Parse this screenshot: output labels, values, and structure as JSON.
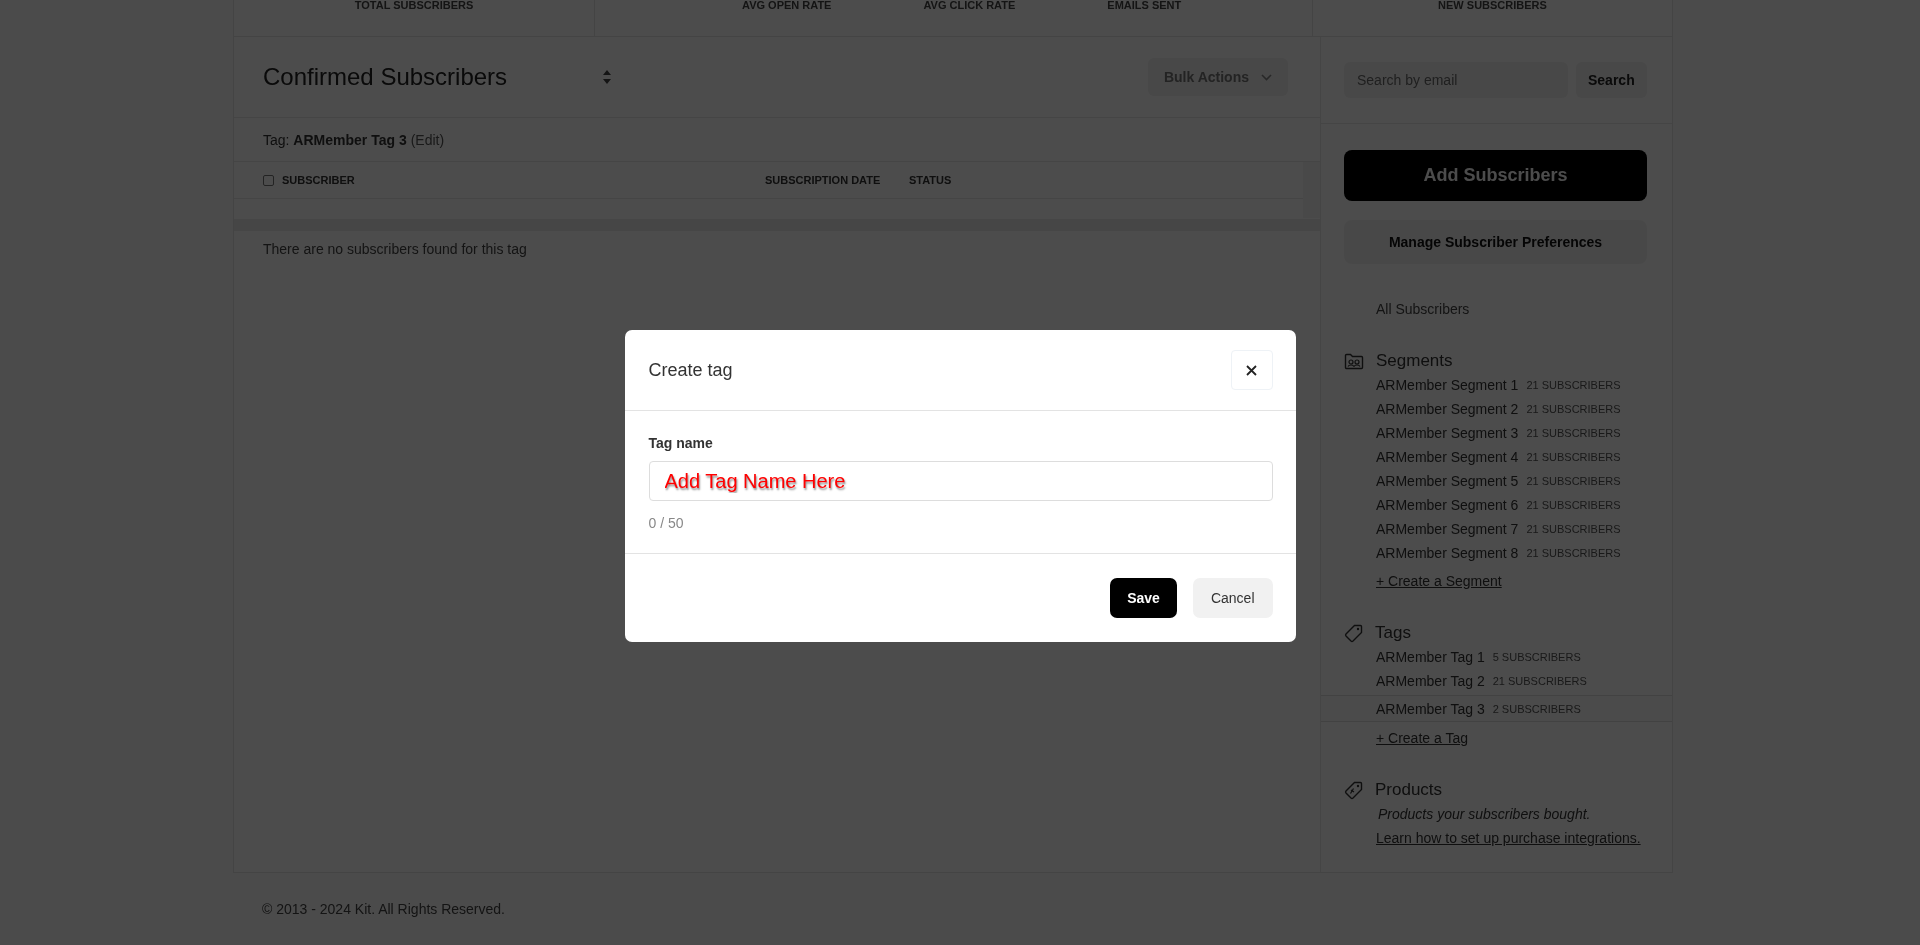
{
  "stats_header": {
    "groups": [
      [
        "TOTAL SUBSCRIBERS"
      ],
      [
        "AVG OPEN RATE",
        "AVG CLICK RATE",
        "EMAILS SENT"
      ],
      [
        "NEW SUBSCRIBERS"
      ]
    ]
  },
  "subscribers_panel": {
    "title": "Confirmed Subscribers",
    "bulk_actions": "Bulk Actions",
    "filter_text": "Tag: **ARMember Tag 3**",
    "filter_edit": "(Edit)",
    "select_all_checked": false,
    "columns": [
      "SUBSCRIBER",
      "SUBSCRIPTION DATE",
      "STATUS"
    ],
    "empty_message": "There are no subscribers found for this tag"
  },
  "sidebar": {
    "search": {
      "placeholder": "Search by email",
      "button": "Search"
    },
    "add_button": "Add Subscribers",
    "manage_button": "Manage Subscriber Preferences",
    "all_link": "All Subscribers",
    "sections": [
      {
        "kind": "segments",
        "title": "Segments",
        "items": [
          {
            "name": "ARMember Segment 1",
            "count": "21 SUBSCRIBERS",
            "selected": false
          },
          {
            "name": "ARMember Segment 2",
            "count": "21 SUBSCRIBERS",
            "selected": false
          },
          {
            "name": "ARMember Segment 3",
            "count": "21 SUBSCRIBERS",
            "selected": false
          },
          {
            "name": "ARMember Segment 4",
            "count": "21 SUBSCRIBERS",
            "selected": false
          },
          {
            "name": "ARMember Segment 5",
            "count": "21 SUBSCRIBERS",
            "selected": false
          },
          {
            "name": "ARMember Segment 6",
            "count": "21 SUBSCRIBERS",
            "selected": false
          },
          {
            "name": "ARMember Segment 7",
            "count": "21 SUBSCRIBERS",
            "selected": false
          },
          {
            "name": "ARMember Segment 8",
            "count": "21 SUBSCRIBERS",
            "selected": false
          }
        ],
        "create_link": "+ Create a Segment"
      },
      {
        "kind": "tags",
        "title": "Tags",
        "items": [
          {
            "name": "ARMember Tag 1",
            "count": "5 SUBSCRIBERS",
            "selected": false
          },
          {
            "name": "ARMember Tag 2",
            "count": "21 SUBSCRIBERS",
            "selected": false
          },
          {
            "name": "ARMember Tag 3",
            "count": "2 SUBSCRIBERS",
            "selected": true
          }
        ],
        "create_link": "+ Create a Tag"
      },
      {
        "kind": "products",
        "title": "Products",
        "description": "Products your subscribers bought.",
        "link": "Learn how to set up purchase integrations."
      }
    ]
  },
  "footer": {
    "text": "© 2013 - 2024 Kit. All Rights Reserved."
  },
  "modal": {
    "title": "Create tag",
    "field_label": "Tag name",
    "placeholder": "Add Tag Name Here",
    "counter": "0 / 50",
    "buttons": [
      {
        "label": "Save",
        "kind": "primary"
      },
      {
        "label": "Cancel",
        "kind": "secondary"
      }
    ]
  }
}
